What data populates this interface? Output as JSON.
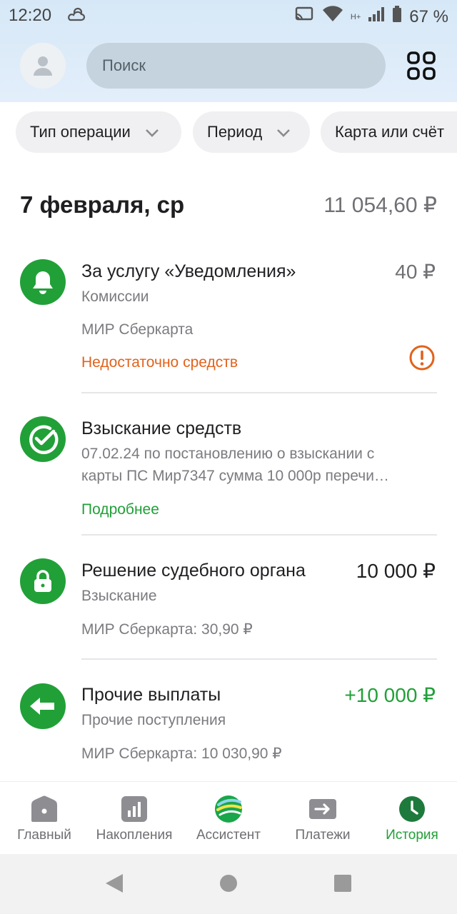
{
  "status_bar": {
    "time": "12:20",
    "battery": "67 %",
    "network": "H+"
  },
  "search": {
    "placeholder": "Поиск"
  },
  "filters": [
    {
      "label": "Тип операции"
    },
    {
      "label": "Период"
    },
    {
      "label": "Карта или счёт"
    }
  ],
  "day": {
    "date": "7 февраля, ср",
    "total": "11 054,60 ₽"
  },
  "transactions": [
    {
      "title": "За услугу «Уведомления»",
      "amount": "40 ₽",
      "category": "Комиссии",
      "card": "МИР Сберкарта",
      "status": "Недостаточно средств"
    },
    {
      "title": "Взыскание средств",
      "line1": "07.02.24 по постановлению о взыскании с",
      "line2": "карты ПС Мир7347 сумма 10 000р перечи…",
      "link": "Подробнее"
    },
    {
      "title": "Решение судебного органа",
      "amount": "10 000 ₽",
      "category": "Взыскание",
      "card": "МИР Сберкарта: 30,90 ₽"
    },
    {
      "title": "Прочие выплаты",
      "amount": "+10 000 ₽",
      "category": "Прочие поступления",
      "card": "МИР Сберкарта: 10 030,90 ₽"
    }
  ],
  "tabs": [
    {
      "label": "Главный"
    },
    {
      "label": "Накопления"
    },
    {
      "label": "Ассистент"
    },
    {
      "label": "Платежи"
    },
    {
      "label": "История"
    }
  ],
  "colors": {
    "brand_green": "#21a038",
    "error_orange": "#e2621b",
    "income_green": "#21a038"
  }
}
